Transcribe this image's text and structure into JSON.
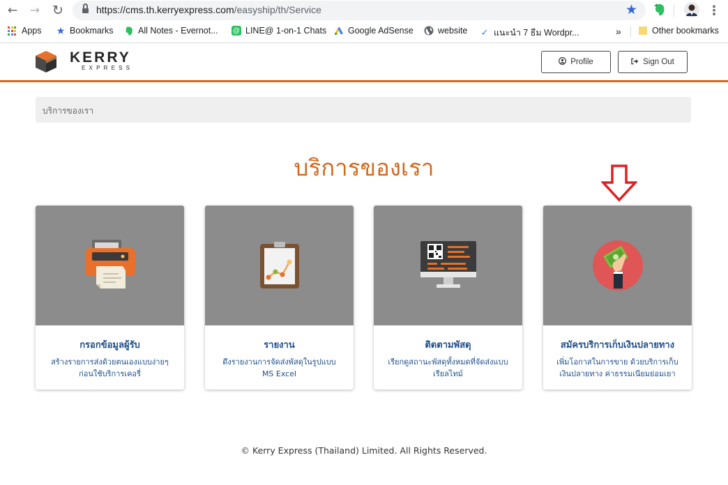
{
  "browser": {
    "url_host": "https://cms.th.kerryexpress.com",
    "url_path": "/easyship/th/Service",
    "bookmarks": [
      {
        "label": "Apps",
        "icon": "apps-grid-icon"
      },
      {
        "label": "Bookmarks",
        "icon": "star-icon"
      },
      {
        "label": "All Notes - Evernot...",
        "icon": "evernote-icon"
      },
      {
        "label": "LINE@ 1-on-1 Chats",
        "icon": "line-icon"
      },
      {
        "label": "Google AdSense",
        "icon": "adsense-icon"
      },
      {
        "label": "website",
        "icon": "globe-icon"
      },
      {
        "label": "แนะนำ 7 ธีม Wordpr...",
        "icon": "checkmark-icon"
      }
    ],
    "overflow_label": "»",
    "other_bookmarks": "Other bookmarks"
  },
  "header": {
    "logo_main": "KERRY",
    "logo_sub": "EXPRESS",
    "profile_label": "Profile",
    "signout_label": "Sign Out"
  },
  "breadcrumb": "บริการของเรา",
  "page_title": "บริการของเรา",
  "cards": [
    {
      "title": "กรอกข้อมูลผู้รับ",
      "desc": "สร้างรายการส่งด้วยตนเองแบบง่ายๆ ก่อนใช้บริการเคอรี่",
      "icon": "printer-icon"
    },
    {
      "title": "รายงาน",
      "desc": "ดึงรายงานการจัดส่งพัสดุในรูปแบบ MS Excel",
      "icon": "report-chart-icon"
    },
    {
      "title": "ติดตามพัสดุ",
      "desc": "เรียกดูสถานะพัสดุทั้งหมดที่จัดส่งแบบเรียลไทม์",
      "icon": "monitor-qr-icon"
    },
    {
      "title": "สมัครบริการเก็บเงินปลายทาง",
      "desc": "เพิ่มโอกาสในการขาย ด้วยบริการเก็บเงินปลายทาง ค่าธรรมเนียมย่อมเยา",
      "icon": "cash-hand-icon"
    }
  ],
  "footer": "© Kerry Express (Thailand) Limited. All Rights Reserved.",
  "colors": {
    "brand": "#d2691e",
    "card_image_bg": "#8c8c8c",
    "card_text": "#1f4e8a",
    "annotation": "#e02020"
  }
}
